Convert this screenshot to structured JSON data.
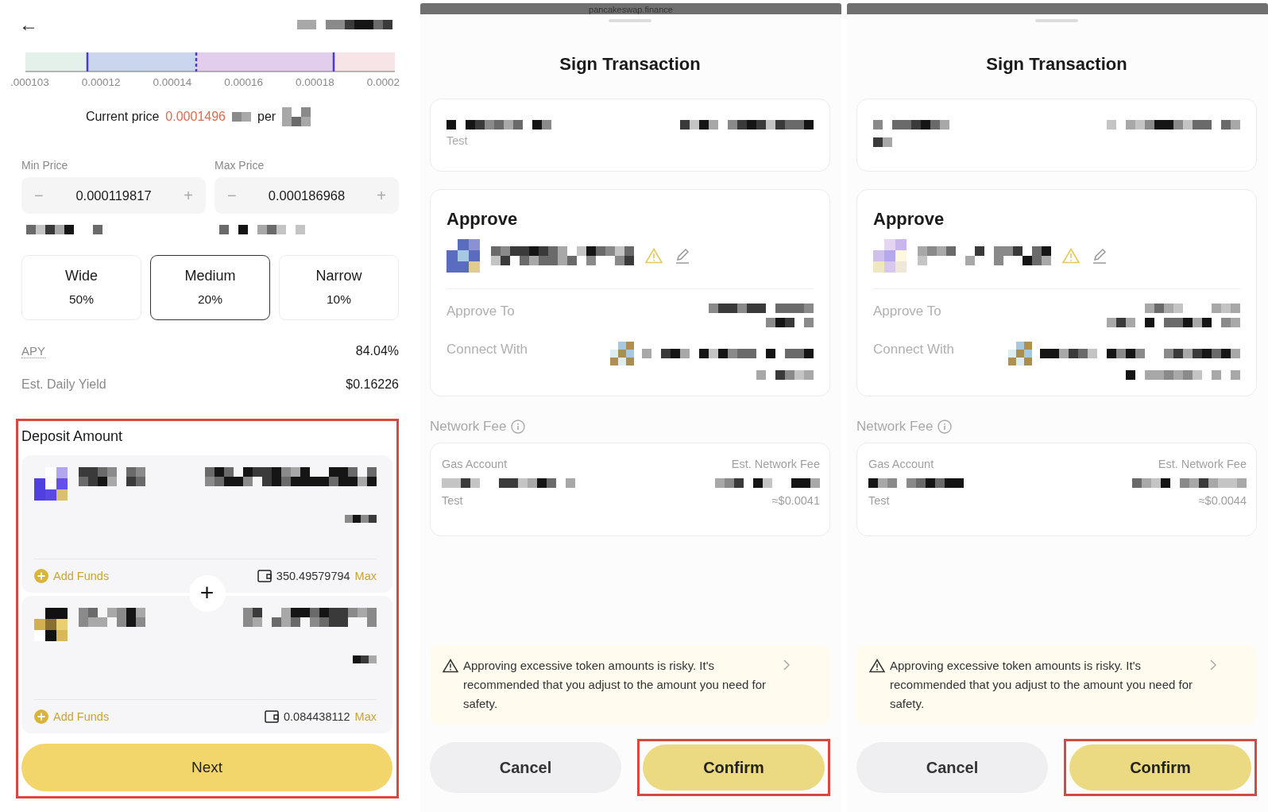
{
  "deposit_screen": {
    "back_button": "←",
    "range_chart": {
      "tick_labels": [
        ".000103",
        "0.00012",
        "0.00014",
        "0.00016",
        "0.00018",
        "0.0002"
      ]
    },
    "current_price": {
      "label": "Current price",
      "value": "0.0001496",
      "per": "per"
    },
    "min_price": {
      "label": "Min Price",
      "minus": "−",
      "value": "0.000119817",
      "plus": "+"
    },
    "max_price": {
      "label": "Max Price",
      "minus": "−",
      "value": "0.000186968",
      "plus": "+"
    },
    "range_options": [
      {
        "label": "Wide",
        "percent": "50%",
        "selected": false
      },
      {
        "label": "Medium",
        "percent": "20%",
        "selected": true
      },
      {
        "label": "Narrow",
        "percent": "10%",
        "selected": false
      }
    ],
    "stats": [
      {
        "label": "APY",
        "value": "84.04%",
        "kind": "dotted"
      },
      {
        "label": "Est. Daily Yield",
        "value": "$0.16226",
        "kind": "plain"
      }
    ],
    "deposit": {
      "title": "Deposit Amount",
      "highlighted": true,
      "join_symbol": "+",
      "tokens": [
        {
          "add_funds": "Add Funds",
          "balance": "350.49579794",
          "max": "Max"
        },
        {
          "add_funds": "Add Funds",
          "balance": "0.084438112",
          "max": "Max"
        }
      ]
    },
    "next_button": "Next"
  },
  "sign_screens": [
    {
      "site": "pancakeswap.finance",
      "title": "Sign Transaction",
      "account_note": "Test",
      "approve_title": "Approve",
      "approve_to": "Approve To",
      "connect_with": "Connect With",
      "network_fee": "Network Fee",
      "gas_account": "Gas Account",
      "est_fee": "Est. Network Fee",
      "gas_note": "Test",
      "fee_usd": "≈$0.0041",
      "warning": "Approving excessive token amounts is risky. It's recommended that you adjust to the amount you need for safety.",
      "cancel": "Cancel",
      "confirm": "Confirm",
      "confirm_highlighted": true
    },
    {
      "title": "Sign Transaction",
      "approve_title": "Approve",
      "approve_to": "Approve To",
      "connect_with": "Connect With",
      "network_fee": "Network Fee",
      "gas_account": "Gas Account",
      "est_fee": "Est. Network Fee",
      "gas_note": "Test",
      "fee_usd": "≈$0.0044",
      "warning": "Approving excessive token amounts is risky. It's recommended that you adjust to the amount you need for safety.",
      "cancel": "Cancel",
      "confirm": "Confirm",
      "confirm_highlighted": true
    }
  ]
}
